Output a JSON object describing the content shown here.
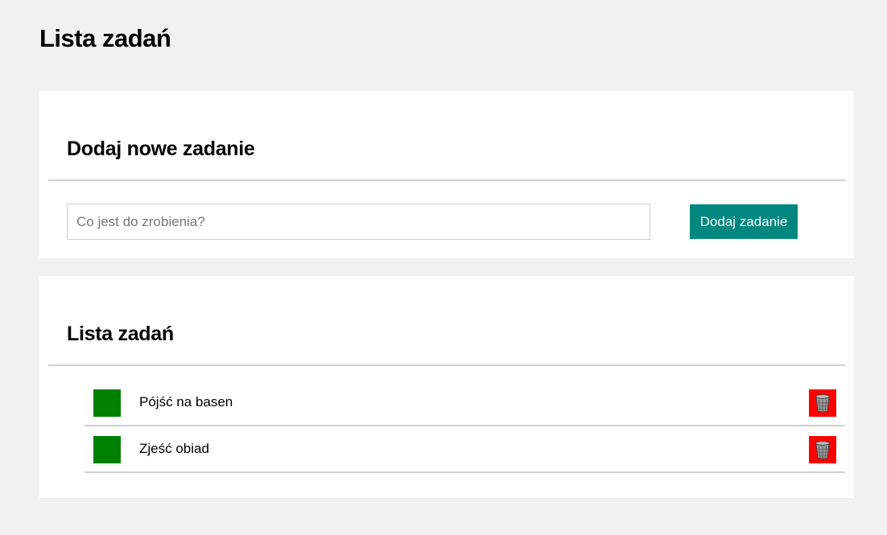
{
  "header": {
    "title": "Lista zadań"
  },
  "add_section": {
    "title": "Dodaj nowe zadanie",
    "input": {
      "value": "",
      "placeholder": "Co jest do zrobienia?"
    },
    "button_label": "Dodaj zadanie"
  },
  "list_section": {
    "title": "Lista zadań",
    "tasks": [
      {
        "text": "Pójść na basen",
        "complete_icon": "green-square",
        "delete_icon": "trash-icon"
      },
      {
        "text": "Zjeść obiad",
        "complete_icon": "green-square",
        "delete_icon": "trash-icon"
      }
    ]
  },
  "colors": {
    "page_background": "#f1f1f1",
    "card_background": "#ffffff",
    "accent_button": "#00877f",
    "complete_marker": "#008000",
    "delete_button": "#ff0000",
    "divider": "#d0d0d0"
  }
}
